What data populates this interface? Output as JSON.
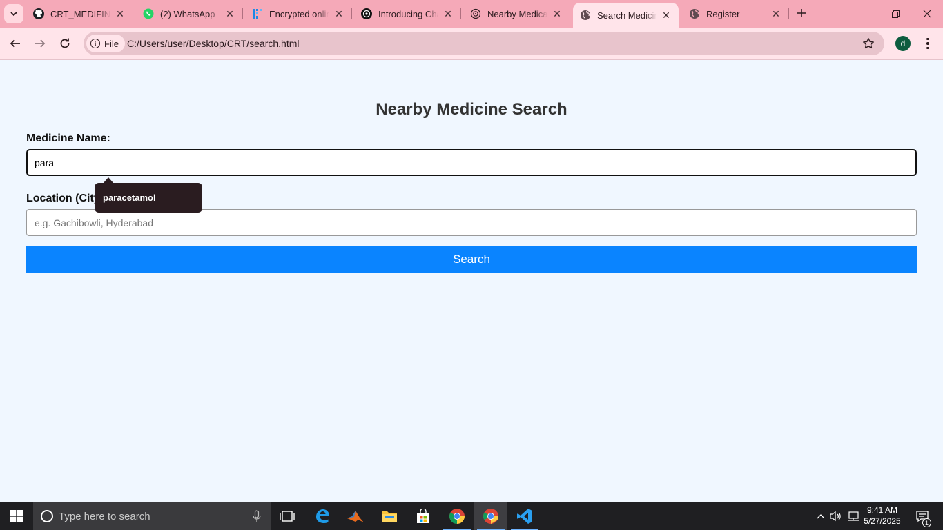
{
  "browser": {
    "tabs": [
      {
        "title": "CRT_MEDIFIND/…",
        "favicon": "github-icon",
        "active": false
      },
      {
        "title": "(2) WhatsApp",
        "favicon": "whatsapp-icon",
        "active": false
      },
      {
        "title": "Encrypted online…",
        "favicon": "blue-logo-icon",
        "active": false
      },
      {
        "title": "Introducing ChatGPT",
        "favicon": "openai-icon",
        "active": false
      },
      {
        "title": "Nearby Medical…",
        "favicon": "openai-icon",
        "active": false
      },
      {
        "title": "Search Medicine",
        "favicon": "globe-icon",
        "active": true
      },
      {
        "title": "Register",
        "favicon": "globe-icon",
        "active": false
      }
    ],
    "address": {
      "chip_label": "File",
      "url": "C:/Users/user/Desktop/CRT/search.html"
    },
    "profile_initial": "d"
  },
  "page": {
    "title": "Nearby Medicine Search",
    "medicine_label": "Medicine Name:",
    "medicine_value": "para",
    "location_label": "Location (City, Area):",
    "location_placeholder": "e.g. Gachibowli, Hyderabad",
    "search_button": "Search",
    "suggestion": "paracetamol"
  },
  "taskbar": {
    "search_placeholder": "Type here to search",
    "time": "9:41 AM",
    "date": "5/27/2025",
    "notification_count": "1"
  },
  "colors": {
    "tab_strip": "#f5a9b8",
    "toolbar": "#ffe4ea",
    "page_background": "#f0f7ff",
    "search_button": "#0a84ff"
  }
}
